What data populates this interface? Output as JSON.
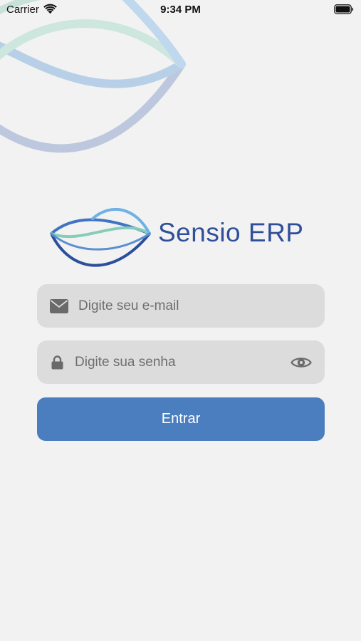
{
  "status_bar": {
    "carrier": "Carrier",
    "time": "9:34 PM",
    "icons": [
      "wifi-icon",
      "battery-icon"
    ]
  },
  "brand": {
    "name": "Sensio ERP",
    "logo_icon": "wave-logo-icon"
  },
  "login": {
    "email": {
      "placeholder": "Digite seu e-mail",
      "value": "",
      "icon": "mail-icon"
    },
    "password": {
      "placeholder": "Digite sua senha",
      "value": "",
      "icon": "lock-icon",
      "toggle_icon": "eye-icon"
    },
    "submit_label": "Entrar"
  },
  "colors": {
    "background": "#f2f2f2",
    "field_background": "#dcdcdc",
    "button": "#4a7ebf",
    "brand_text": "#2f4f9a",
    "wave_light_blue": "#8fbfe6",
    "wave_green": "#8fd0c0",
    "wave_dark_blue": "#2c4f9c"
  }
}
